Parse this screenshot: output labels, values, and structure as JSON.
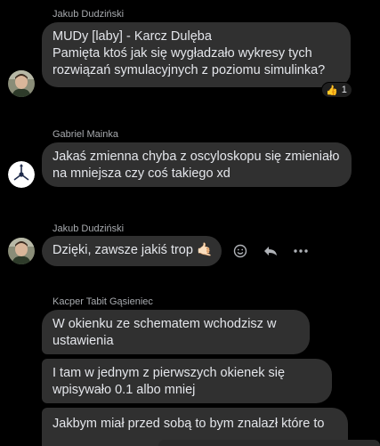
{
  "messages": [
    {
      "sender": "Jakub Dudziński",
      "lines": [
        "MUDy [laby] - Karcz Dulęba",
        "Pamięta ktoś jak się wygładzało wykresy tych",
        "rozwiązań symulacyjnych z poziomu simulinka?"
      ],
      "reaction": {
        "emoji": "👍",
        "count": "1"
      }
    },
    {
      "sender": "Gabriel Mainka",
      "lines": [
        "Jakaś zmienna chyba z oscyloskopu się zmieniało",
        "na mniejsza czy coś takiego xd"
      ]
    },
    {
      "sender": "Jakub Dudziński",
      "lines": [
        "Dzięki, zawsze jakiś trop 🤙🏻"
      ]
    },
    {
      "sender": "Kacper Tabit Gąsieniec",
      "bubbles": [
        [
          "W okienku ze schematem wchodzisz w",
          "ustawienia"
        ],
        [
          "I tam w jednym z pierwszych okienek się",
          "wpisywało 0.1 albo mniej"
        ],
        [
          "Jakbym miał przed sobą to bym znalazł które to"
        ]
      ]
    }
  ],
  "actions": {
    "react_icon": "smiley-icon",
    "reply_icon": "reply-arrow-icon",
    "more_icon": "more-dots-icon"
  },
  "colors": {
    "background": "#000000",
    "bubble": "#303030",
    "text": "#e4e6eb",
    "sender": "#a8abaf"
  }
}
